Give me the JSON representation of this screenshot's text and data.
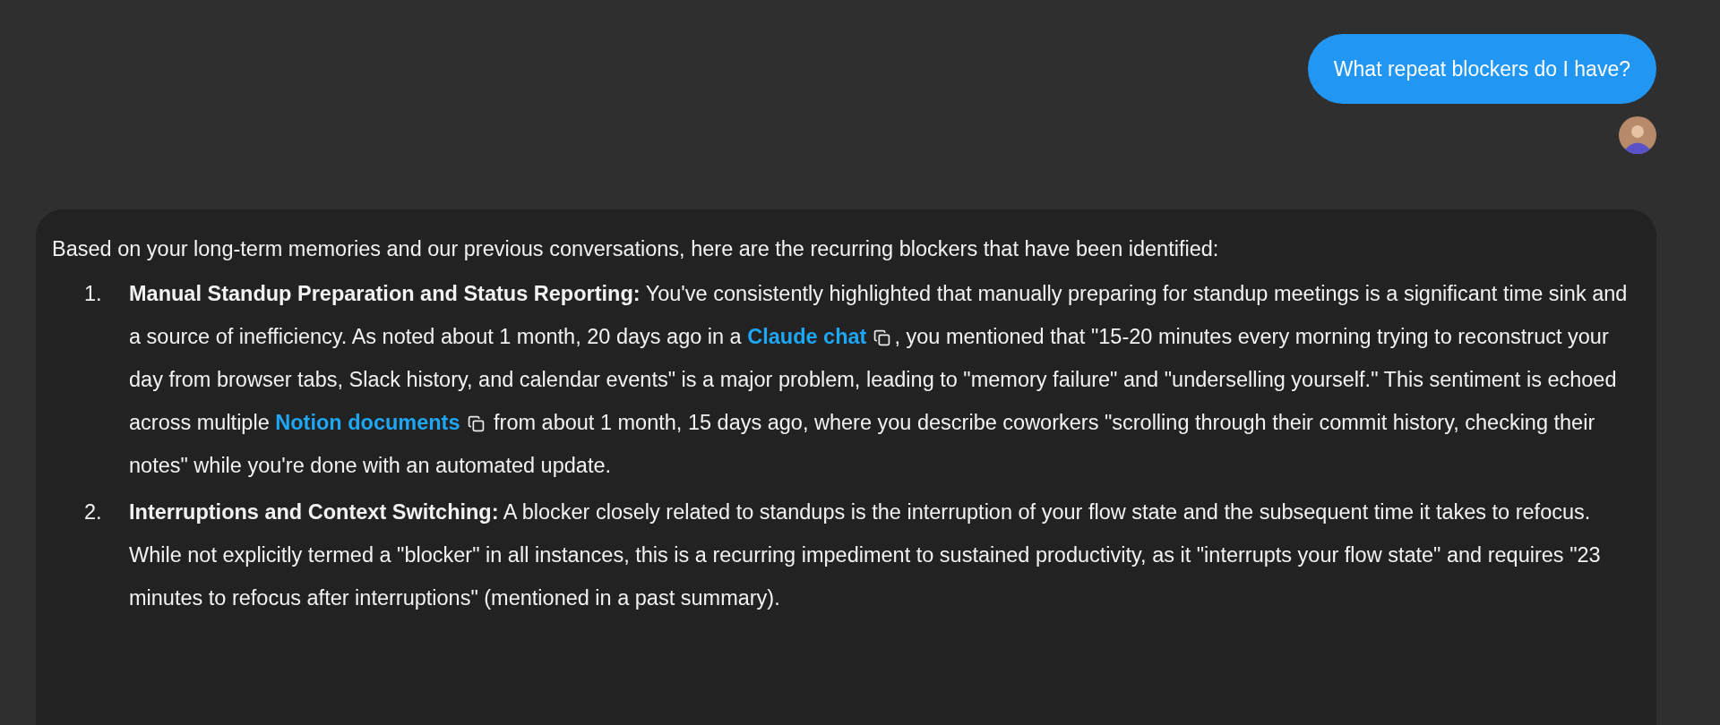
{
  "user_message": {
    "text": "What repeat blockers do I have?"
  },
  "assistant_message": {
    "intro": "Based on your long-term memories and our previous conversations, here are the recurring blockers that have been identified:",
    "items": [
      {
        "number": "1.",
        "segments": [
          {
            "kind": "text",
            "text": "**Manual Standup Preparation and Status Reporting:** You've consistently highlighted that manually preparing for standup meetings is a significant time sink and a source of inefficiency. As noted about 1 month, 20 days ago in a "
          },
          {
            "kind": "link",
            "text": "Claude chat"
          },
          {
            "kind": "text",
            "text": ", you mentioned that \"15-20 minutes every morning trying to reconstruct your day from browser tabs, Slack history, and calendar events\" is a major problem, leading to \"memory failure\" and \"underselling yourself.\" This sentiment is echoed across multiple "
          },
          {
            "kind": "link",
            "text": "Notion documents"
          },
          {
            "kind": "text",
            "text": " from about 1 month, 15 days ago, where you describe coworkers \"scrolling through their commit history, checking their notes\" while you're done with an automated update."
          }
        ]
      },
      {
        "number": "2.",
        "segments": [
          {
            "kind": "text",
            "text": "**Interruptions and Context Switching:** A blocker closely related to standups is the interruption of your flow state and the subsequent time it takes to refocus. While not explicitly termed a \"blocker\" in all instances, this is a recurring impediment to sustained productivity, as it \"interrupts your flow state\" and requires \"23 minutes to refocus after interruptions\" (mentioned in a past summary)."
          }
        ]
      }
    ]
  }
}
